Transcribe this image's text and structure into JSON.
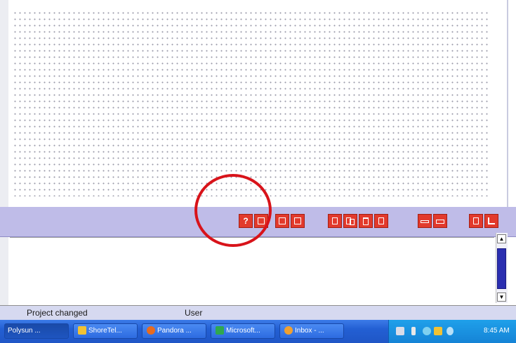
{
  "toolbar": {
    "help_button": "?",
    "icons": [
      "help-icon",
      "open-folder-icon",
      "new-document-icon",
      "save-icon",
      "document-icon",
      "copy-icon",
      "delete-icon",
      "paste-icon",
      "minimize-icon",
      "maximize-icon",
      "report-icon",
      "chart-icon"
    ]
  },
  "status": {
    "message": "Project changed",
    "user": "User"
  },
  "taskbar": {
    "tasks": [
      "Polysun ...",
      "ShoreTel...",
      "Pandora ...",
      "Microsoft...",
      "Inbox - ..."
    ],
    "clock": "8:45 AM"
  },
  "colors": {
    "toolbar_bg": "#bfbce8",
    "toolbar_button": "#e23a2c",
    "annotation": "#d8131a",
    "taskbar": "#235fd3"
  }
}
